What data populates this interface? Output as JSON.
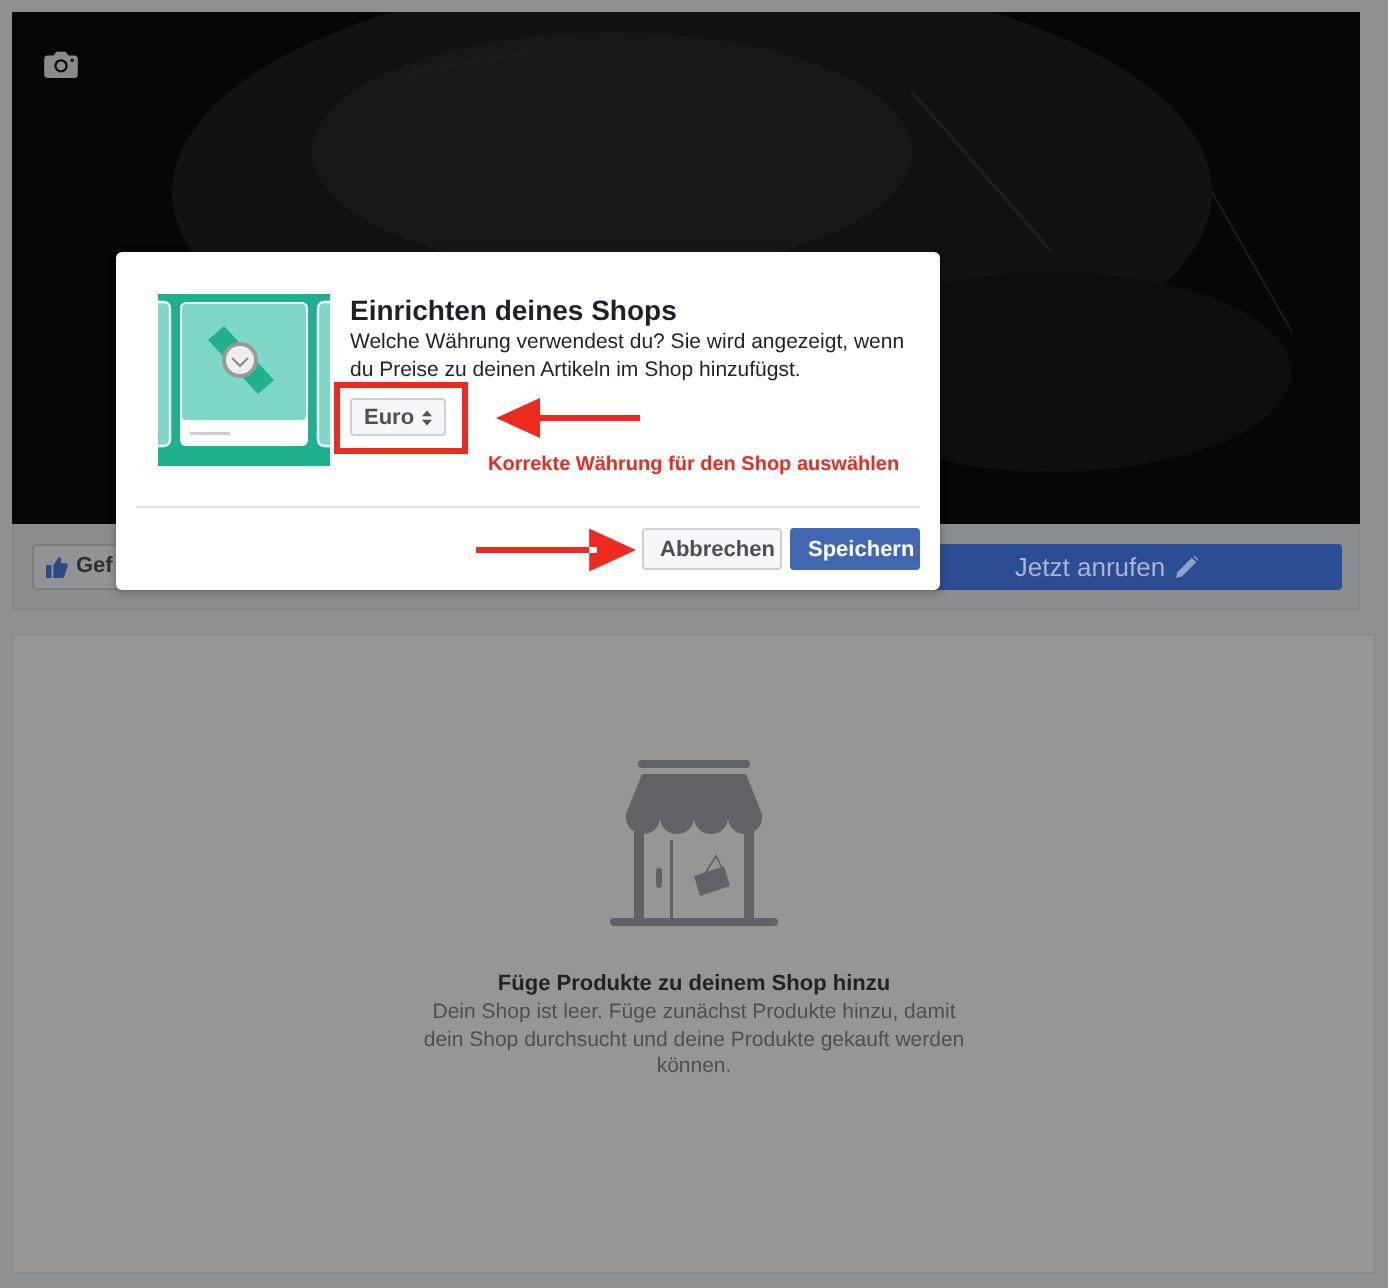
{
  "page_actions": [
    {
      "kind": "like",
      "label": "Gef"
    },
    {
      "kind": "call",
      "label": "Jetzt anrufen"
    }
  ],
  "dialog": {
    "title": "Einrichten deines Shops",
    "description": "Welche Währung verwendest du? Sie wird angezeigt, wenn du Preise zu deinen Artikeln im Shop hinzufügst.",
    "currency_select": {
      "value": "Euro"
    },
    "annotation": "Korrekte Währung für den Shop auswählen",
    "buttons": [
      {
        "kind": "secondary",
        "label": "Abbrechen"
      },
      {
        "kind": "primary",
        "label": "Speichern"
      }
    ]
  },
  "shop_empty": {
    "heading": "Füge Produkte zu deinem Shop hinzu",
    "text": "Dein Shop ist leer. Füge zunächst Produkte hinzu, damit dein Shop durchsucht und deine Produkte gekauft werden können."
  }
}
